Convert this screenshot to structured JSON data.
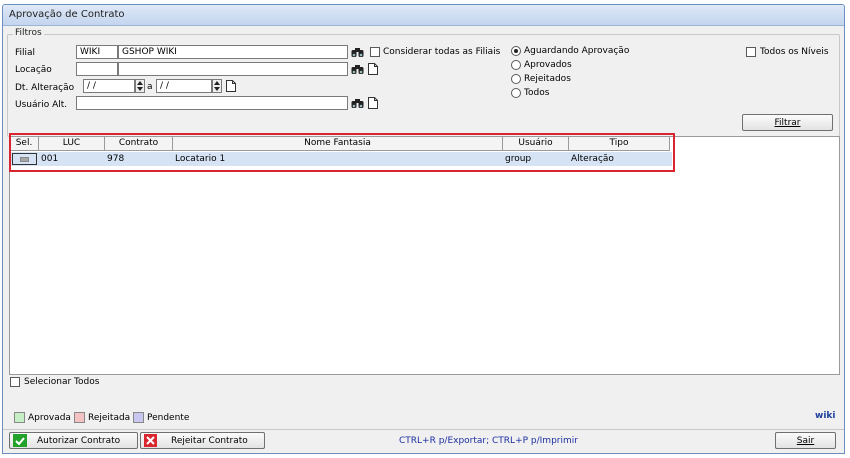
{
  "window": {
    "title": "Aprovação de Contrato"
  },
  "filters": {
    "legend": "Filtros",
    "filial_label": "Filial",
    "filial_code": "WIKI",
    "filial_name": "GSHOP WIKI",
    "locacao_label": "Locação",
    "locacao_code": "",
    "locacao_name": "",
    "dt_label": "Dt. Alteração",
    "dt_from": " / /",
    "dt_sep": "a",
    "dt_to": " / /",
    "usuario_label": "Usuário Alt.",
    "usuario_value": "",
    "consider_all": "Considerar todas as Filiais",
    "status_options": [
      "Aguardando Aprovação",
      "Aprovados",
      "Rejeitados",
      "Todos"
    ],
    "status_selected": "Aguardando Aprovação",
    "all_levels": "Todos os Níveis",
    "filter_button": "Filtrar"
  },
  "grid": {
    "columns": [
      "Sel.",
      "LUC",
      "Contrato",
      "Nome Fantasia",
      "Usuário",
      "Tipo"
    ],
    "rows": [
      {
        "luc": "001",
        "contrato": "978",
        "nome": "Locatario 1",
        "usuario": "group",
        "tipo": "Alteração"
      }
    ]
  },
  "select_all": "Selecionar Todos",
  "legend": {
    "aprovada": "Aprovada",
    "rejeitada": "Rejeitada",
    "pendente": "Pendente",
    "colors": {
      "aprovada": "#c6efc6",
      "rejeitada": "#f4c2c2",
      "pendente": "#c7c7f0"
    }
  },
  "brand": "wiki",
  "footer": {
    "authorize": "Autorizar Contrato",
    "reject": "Rejeitar Contrato",
    "shortcut_hint": "CTRL+R p/Exportar; CTRL+P p/Imprimir",
    "exit": "Sair"
  }
}
